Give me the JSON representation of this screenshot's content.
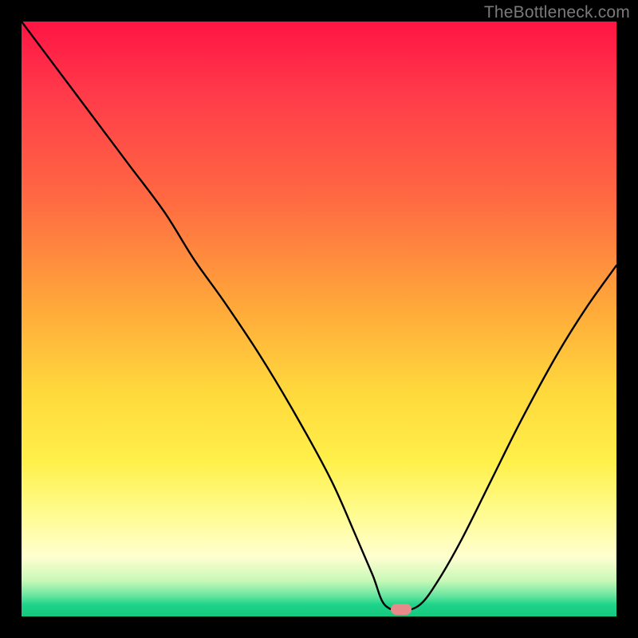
{
  "watermark": "TheBottleneck.com",
  "marker": {
    "x_frac": 0.638,
    "y_frac": 0.988
  },
  "chart_data": {
    "type": "line",
    "title": "",
    "xlabel": "",
    "ylabel": "",
    "xlim": [
      0,
      1
    ],
    "ylim": [
      0,
      1
    ],
    "series": [
      {
        "name": "bottleneck-curve",
        "x": [
          0.0,
          0.06,
          0.12,
          0.18,
          0.24,
          0.29,
          0.34,
          0.4,
          0.46,
          0.52,
          0.56,
          0.59,
          0.61,
          0.64,
          0.67,
          0.7,
          0.74,
          0.79,
          0.84,
          0.9,
          0.95,
          1.0
        ],
        "y": [
          1.0,
          0.92,
          0.84,
          0.76,
          0.68,
          0.6,
          0.53,
          0.44,
          0.34,
          0.23,
          0.14,
          0.07,
          0.02,
          0.01,
          0.02,
          0.06,
          0.13,
          0.23,
          0.33,
          0.44,
          0.52,
          0.59
        ]
      }
    ],
    "annotations": [
      {
        "type": "marker",
        "shape": "pill",
        "color": "#e88a8a",
        "x": 0.638,
        "y": 0.012
      }
    ],
    "background_gradient": {
      "direction": "vertical",
      "stops": [
        {
          "pos": 0.0,
          "color": "#ff1444"
        },
        {
          "pos": 0.3,
          "color": "#ff6a42"
        },
        {
          "pos": 0.62,
          "color": "#ffd83c"
        },
        {
          "pos": 0.9,
          "color": "#ffffd0"
        },
        {
          "pos": 1.0,
          "color": "#14c87e"
        }
      ]
    }
  }
}
